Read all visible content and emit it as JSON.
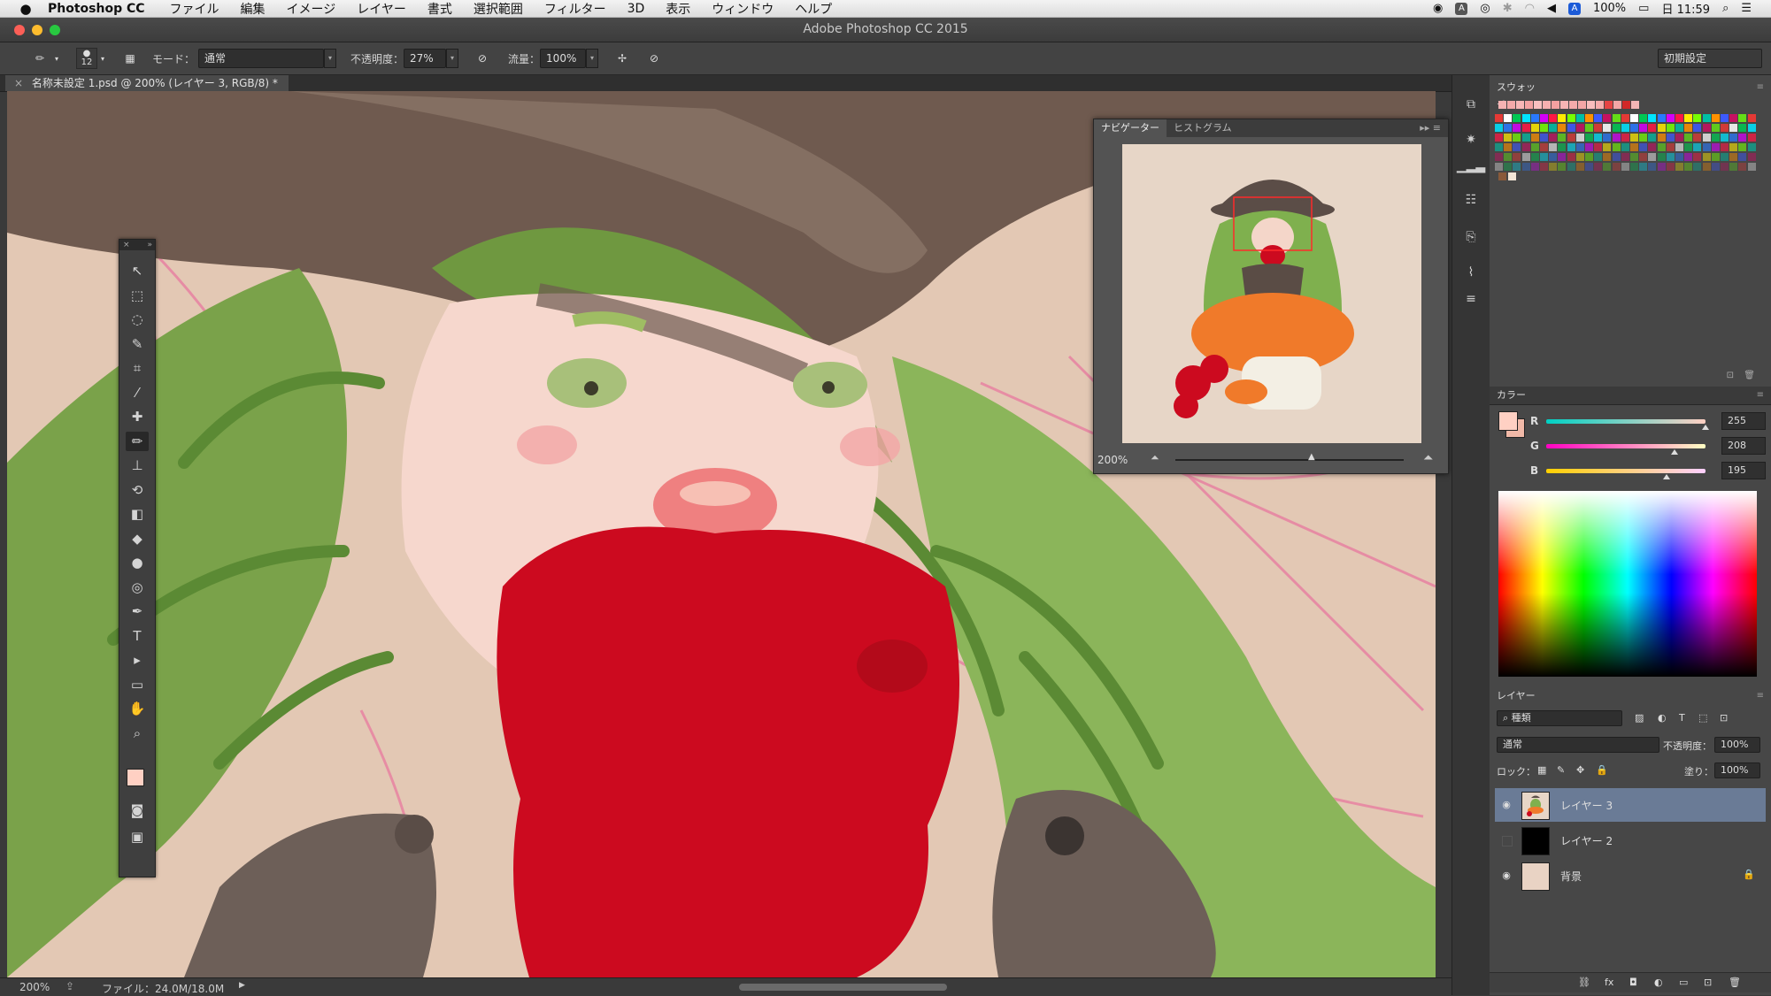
{
  "menubar": {
    "app_name": "Photoshop CC",
    "menus": [
      "ファイル",
      "編集",
      "イメージ",
      "レイヤー",
      "書式",
      "選択範囲",
      "フィルター",
      "3D",
      "表示",
      "ウィンドウ",
      "ヘルプ"
    ],
    "battery": "100%",
    "clock": "日 11:59"
  },
  "window": {
    "title": "Adobe Photoshop CC 2015"
  },
  "options": {
    "brush_size": "12",
    "mode_label": "モード：",
    "mode_value": "通常",
    "opacity_label": "不透明度：",
    "opacity_value": "27%",
    "flow_label": "流量：",
    "flow_value": "100%",
    "workspace": "初期設定"
  },
  "document": {
    "tab_title": "名称未設定 1.psd @ 200% (レイヤー 3, RGB/8) *",
    "zoom": "200%",
    "file_info": "ファイル：24.0M/18.0M"
  },
  "tools": [
    {
      "name": "move-tool",
      "glyph": "↖"
    },
    {
      "name": "marquee-tool",
      "glyph": "⬚"
    },
    {
      "name": "lasso-tool",
      "glyph": "◌"
    },
    {
      "name": "quick-select-tool",
      "glyph": "✎"
    },
    {
      "name": "crop-tool",
      "glyph": "⌗"
    },
    {
      "name": "eyedropper-tool",
      "glyph": "⁄"
    },
    {
      "name": "healing-tool",
      "glyph": "✚"
    },
    {
      "name": "brush-tool",
      "glyph": "✏"
    },
    {
      "name": "stamp-tool",
      "glyph": "⊥"
    },
    {
      "name": "history-brush-tool",
      "glyph": "⟲"
    },
    {
      "name": "eraser-tool",
      "glyph": "◧"
    },
    {
      "name": "paint-bucket-tool",
      "glyph": "◆"
    },
    {
      "name": "blur-tool",
      "glyph": "●"
    },
    {
      "name": "dodge-tool",
      "glyph": "◎"
    },
    {
      "name": "pen-tool",
      "glyph": "✒"
    },
    {
      "name": "type-tool",
      "glyph": "T"
    },
    {
      "name": "path-select-tool",
      "glyph": "▸"
    },
    {
      "name": "shape-tool",
      "glyph": "▭"
    },
    {
      "name": "hand-tool",
      "glyph": "✋"
    },
    {
      "name": "zoom-tool",
      "glyph": "⌕"
    }
  ],
  "navigator": {
    "tab1": "ナビゲーター",
    "tab2": "ヒストグラム",
    "zoom": "200%"
  },
  "swatches": {
    "title": "スウォッチ"
  },
  "color": {
    "title": "カラー",
    "r_label": "R",
    "r": "255",
    "g_label": "G",
    "g": "208",
    "b_label": "B",
    "b": "195",
    "foreground": "#ffd0c3"
  },
  "layers": {
    "title": "レイヤー",
    "filter": "種類",
    "blend": "通常",
    "opacity_label": "不透明度：",
    "opacity": "100%",
    "lock_label": "ロック：",
    "fill_label": "塗り：",
    "fill": "100%",
    "items": [
      {
        "name": "レイヤー 3",
        "visible": true,
        "selected": true
      },
      {
        "name": "レイヤー 2",
        "visible": false,
        "selected": false
      },
      {
        "name": "背景",
        "visible": true,
        "selected": false
      }
    ]
  }
}
